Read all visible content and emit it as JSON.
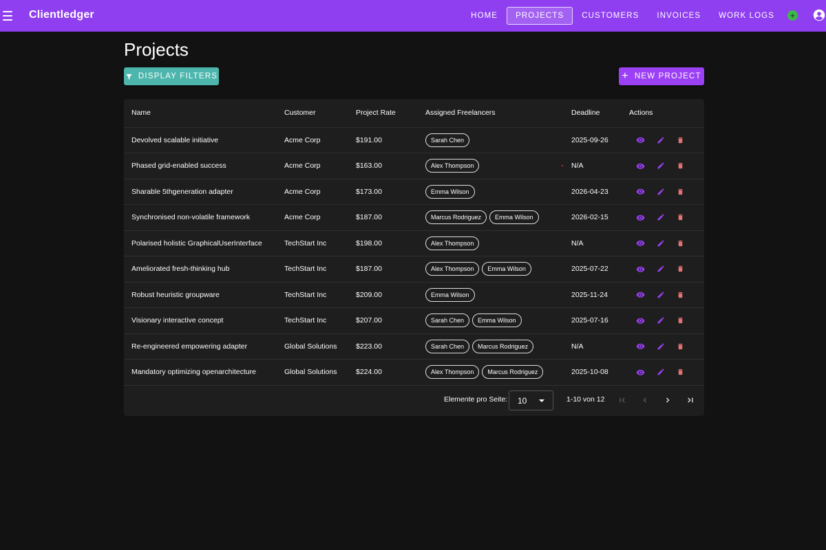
{
  "app": {
    "title": "Clientledger"
  },
  "nav": {
    "items": [
      {
        "label": "Home",
        "active": false
      },
      {
        "label": "Projects",
        "active": true
      },
      {
        "label": "Customers",
        "active": false
      },
      {
        "label": "Invoices",
        "active": false
      },
      {
        "label": "Work Logs",
        "active": false
      }
    ],
    "status_icon": "plus-circle-icon",
    "account_icon": "account-circle-icon"
  },
  "page": {
    "title": "Projects",
    "filters_label": "Display Filters",
    "new_project_label": "New Project"
  },
  "table": {
    "headers": [
      "Name",
      "Customer",
      "Project Rate",
      "Assigned Freelancers",
      "Deadline",
      "Actions"
    ],
    "rows": [
      {
        "name": "Devolved scalable initiative",
        "customer": "Acme Corp",
        "rate": "$191.00",
        "freelancers": [
          "Sarah Chen"
        ],
        "deadline": "2025-09-26"
      },
      {
        "name": "Phased grid-enabled success",
        "customer": "Acme Corp",
        "rate": "$163.00",
        "freelancers": [
          "Alex Thompson"
        ],
        "deadline": "N/A"
      },
      {
        "name": "Sharable 5thgeneration adapter",
        "customer": "Acme Corp",
        "rate": "$173.00",
        "freelancers": [
          "Emma Wilson"
        ],
        "deadline": "2026-04-23"
      },
      {
        "name": "Synchronised non-volatile framework",
        "customer": "Acme Corp",
        "rate": "$187.00",
        "freelancers": [
          "Marcus Rodriguez",
          "Emma Wilson"
        ],
        "deadline": "2026-02-15"
      },
      {
        "name": "Polarised holistic GraphicalUserInterface",
        "customer": "TechStart Inc",
        "rate": "$198.00",
        "freelancers": [
          "Alex Thompson"
        ],
        "deadline": "N/A"
      },
      {
        "name": "Ameliorated fresh-thinking hub",
        "customer": "TechStart Inc",
        "rate": "$187.00",
        "freelancers": [
          "Alex Thompson",
          "Emma Wilson"
        ],
        "deadline": "2025-07-22"
      },
      {
        "name": "Robust heuristic groupware",
        "customer": "TechStart Inc",
        "rate": "$209.00",
        "freelancers": [
          "Emma Wilson"
        ],
        "deadline": "2025-11-24"
      },
      {
        "name": "Visionary interactive concept",
        "customer": "TechStart Inc",
        "rate": "$207.00",
        "freelancers": [
          "Sarah Chen",
          "Emma Wilson"
        ],
        "deadline": "2025-07-16"
      },
      {
        "name": "Re-engineered empowering adapter",
        "customer": "Global Solutions",
        "rate": "$223.00",
        "freelancers": [
          "Sarah Chen",
          "Marcus Rodriguez"
        ],
        "deadline": "N/A"
      },
      {
        "name": "Mandatory optimizing openarchitecture",
        "customer": "Global Solutions",
        "rate": "$224.00",
        "freelancers": [
          "Alex Thompson",
          "Marcus Rodriguez"
        ],
        "deadline": "2025-10-08"
      }
    ]
  },
  "pagination": {
    "per_page_label": "Elemente pro Seite:",
    "per_page_value": "10",
    "range_label": "1-10 von 12"
  },
  "colors": {
    "topbar": "#8f3ff0",
    "filters_button": "#4db6ac",
    "new_button": "#9c40f5",
    "view_icon": "#9c40f5",
    "edit_icon": "#9c40f5",
    "delete_icon": "#e57373"
  }
}
